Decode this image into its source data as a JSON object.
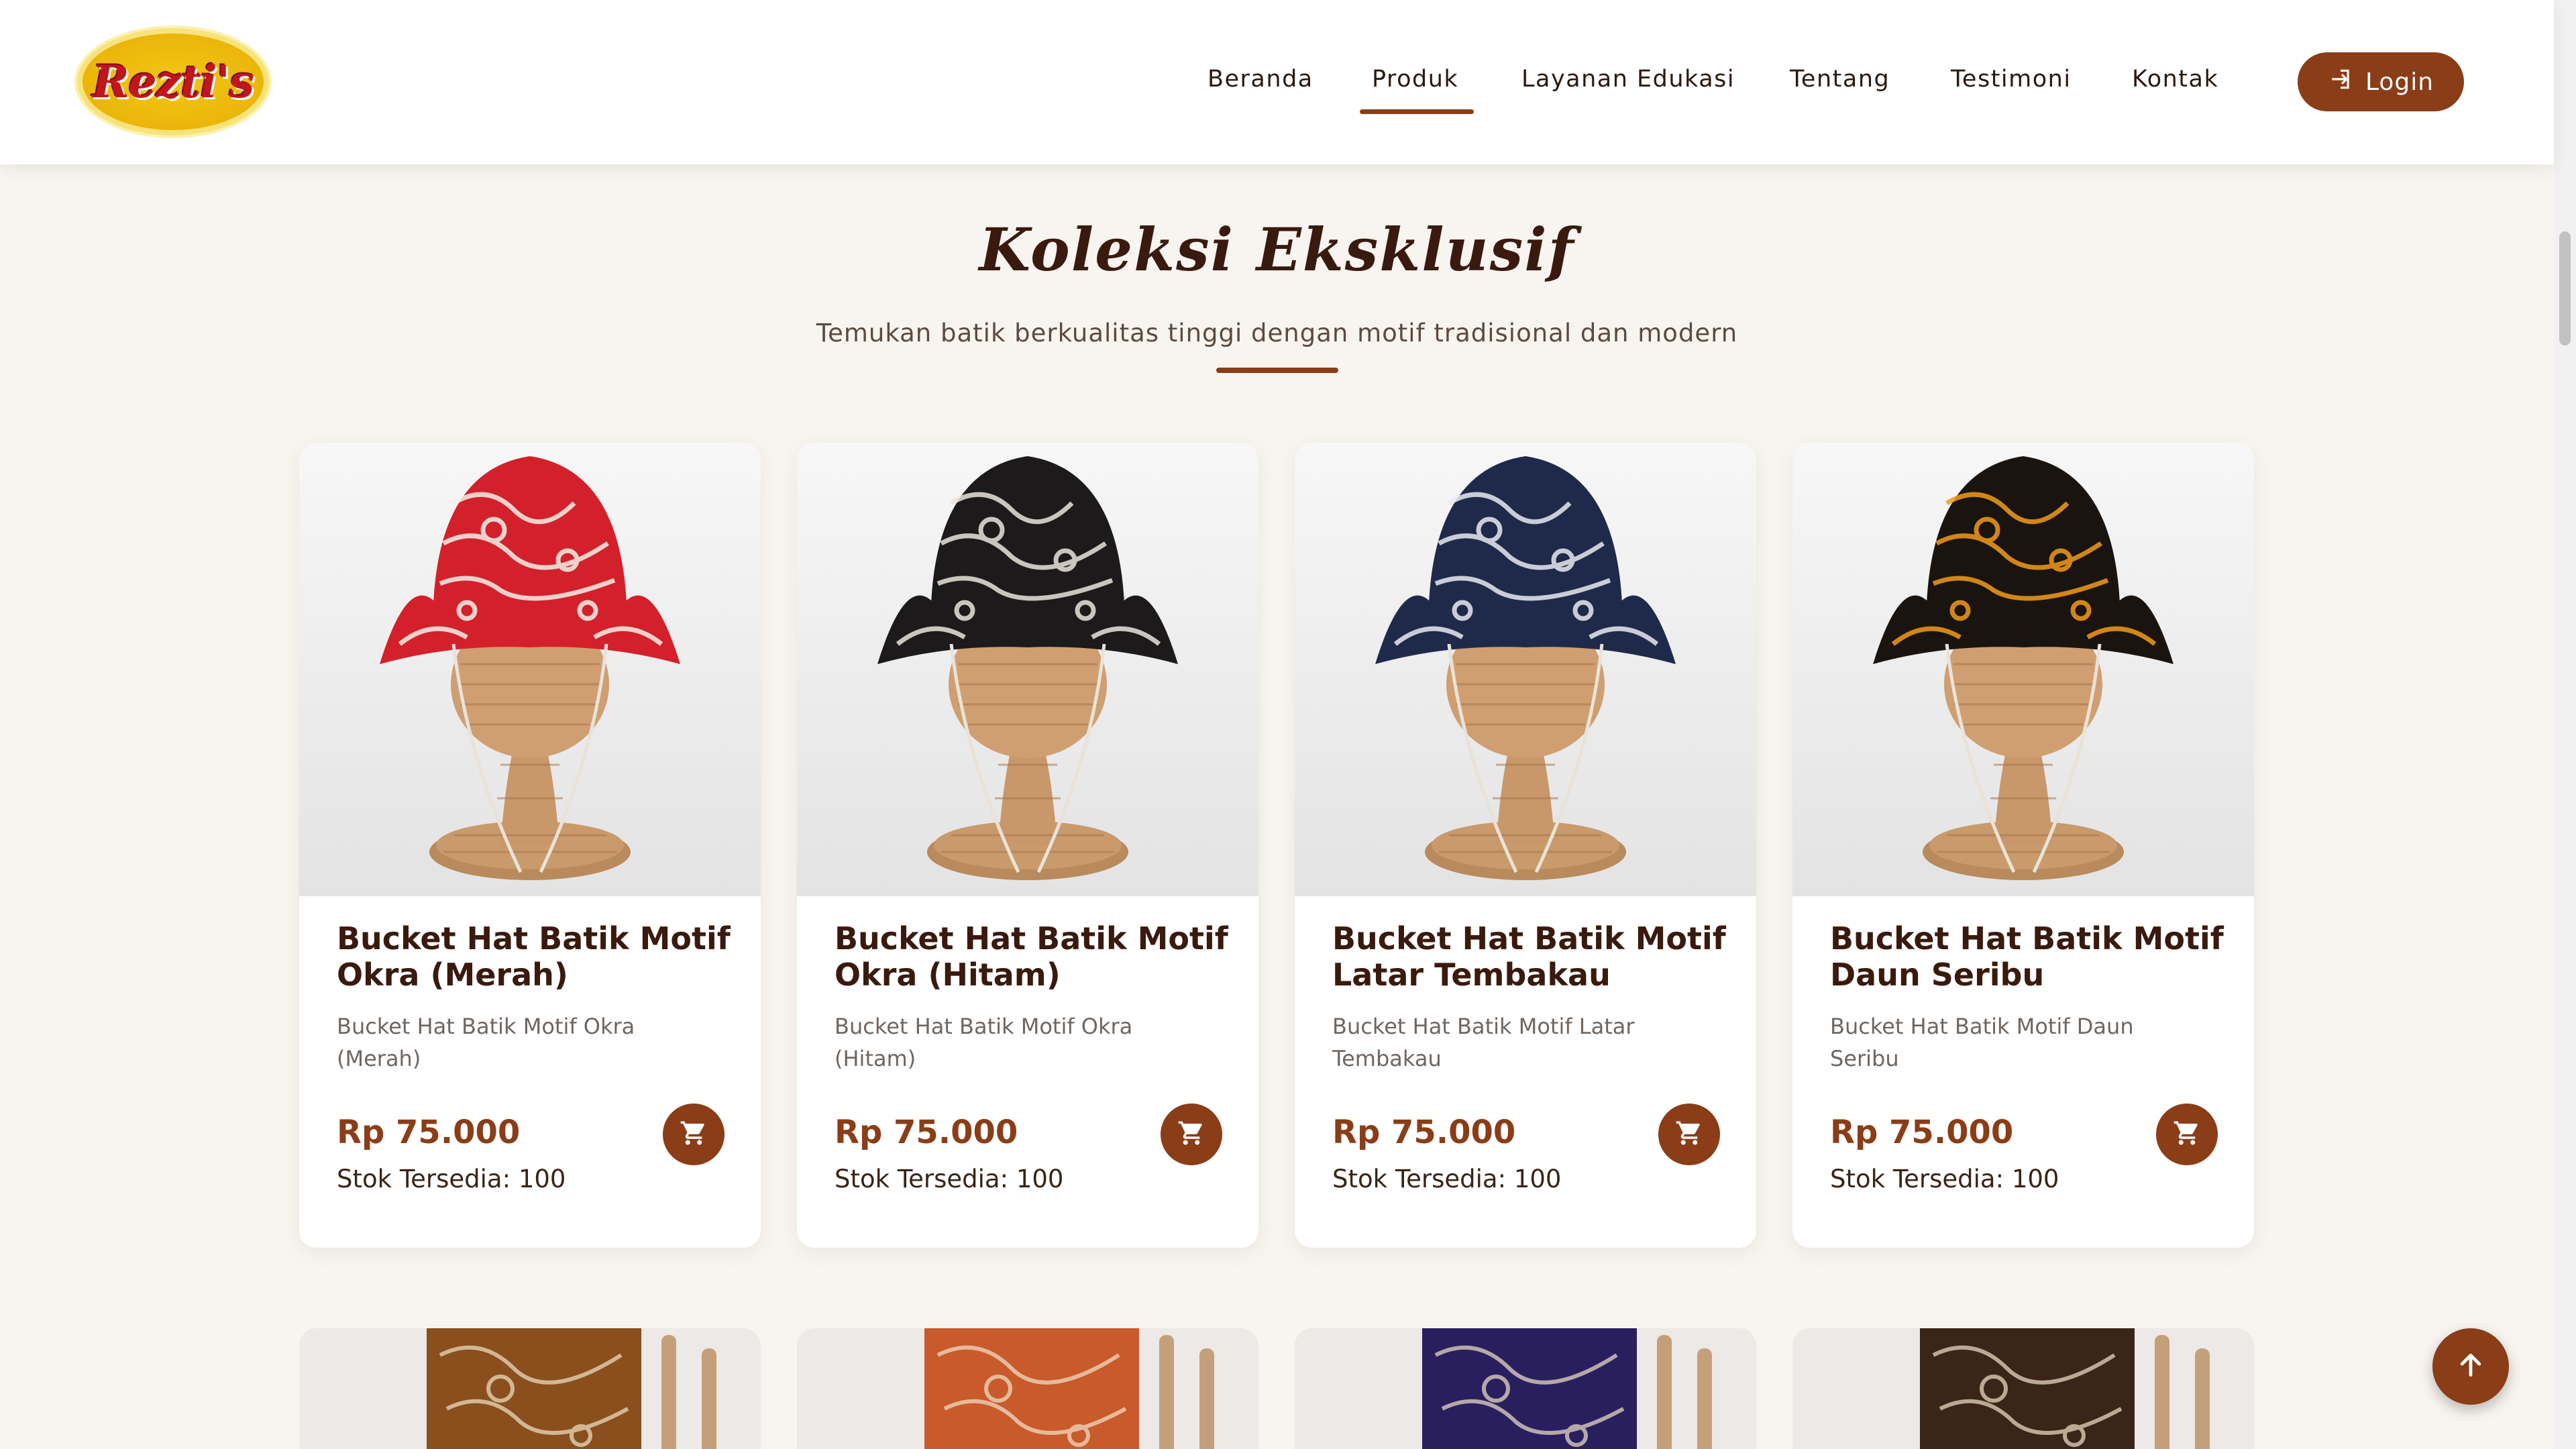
{
  "brand": {
    "logo_text": "Rezti's"
  },
  "nav": {
    "items": [
      "Beranda",
      "Produk",
      "Layanan Edukasi",
      "Tentang",
      "Testimoni",
      "Kontak"
    ],
    "active": "Produk",
    "login_label": "Login"
  },
  "section": {
    "title": "Koleksi Eksklusif",
    "subtitle": "Temukan batik berkualitas tinggi dengan motif tradisional dan modern"
  },
  "products": [
    {
      "title": "Bucket Hat Batik Motif Okra (Merah)",
      "desc": "Bucket Hat Batik Motif Okra (Merah)",
      "price": "Rp 75.000",
      "stock": "Stok Tersedia: 100",
      "hat_color": "#d4202a",
      "pattern_color": "#f3f0e8"
    },
    {
      "title": "Bucket Hat Batik Motif Okra (Hitam)",
      "desc": "Bucket Hat Batik Motif Okra (Hitam)",
      "price": "Rp 75.000",
      "stock": "Stok Tersedia: 100",
      "hat_color": "#1c1a1a",
      "pattern_color": "#e9e4dc"
    },
    {
      "title": "Bucket Hat Batik Motif Latar Tembakau",
      "desc": "Bucket Hat Batik Motif Latar Tembakau",
      "price": "Rp 75.000",
      "stock": "Stok Tersedia: 100",
      "hat_color": "#1f2a4a",
      "pattern_color": "#e8eaf0"
    },
    {
      "title": "Bucket Hat Batik Motif Daun Seribu",
      "desc": "Bucket Hat Batik Motif Daun Seribu",
      "price": "Rp 75.000",
      "stock": "Stok Tersedia: 100",
      "hat_color": "#1a1410",
      "pattern_color": "#f29b1a"
    }
  ],
  "second_row_colors": [
    "#8a4f1d",
    "#c95a2c",
    "#2a1f5e",
    "#3b2418"
  ],
  "icons": {
    "login": "sign-in-icon",
    "cart": "cart-icon",
    "back_to_top": "arrow-up-icon"
  },
  "colors": {
    "accent": "#8a3d17",
    "background": "#f8f5f0",
    "title": "#3a1a0e"
  }
}
